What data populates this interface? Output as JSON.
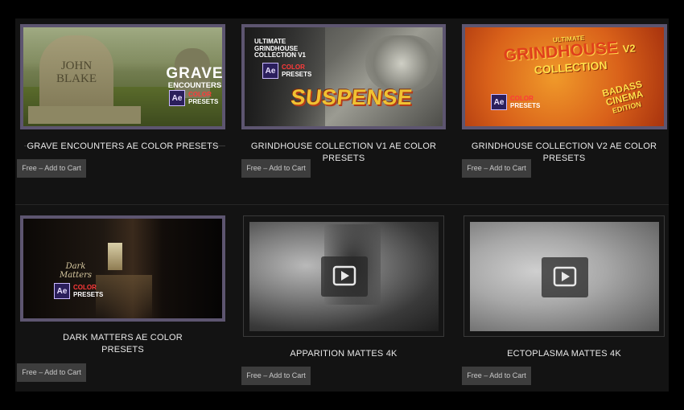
{
  "products": [
    {
      "title": "GRAVE ENCOUNTERS AE COLOR PRESETS",
      "button": "Free – Add to Cart",
      "thumb": {
        "headline_1": "GRAVE",
        "headline_2": "ENCOUNTERS",
        "stone_1": "JOHN",
        "stone_2": "BLAKE",
        "ae": "Ae",
        "ae_line_1": "COLOR",
        "ae_line_2": "PRESETS"
      }
    },
    {
      "title": "GRINDHOUSE COLLECTION V1 AE COLOR PRESETS",
      "button": "Free – Add to Cart",
      "thumb": {
        "top_1": "ULTIMATE",
        "top_2": "GRINDHOUSE",
        "top_3": "COLLECTION V1",
        "ae": "Ae",
        "ae_line_1": "COLOR",
        "ae_line_2": "PRESETS",
        "headline": "SUSPENSE"
      }
    },
    {
      "title": "GRINDHOUSE COLLECTION V2 AE COLOR PRESETS",
      "button": "Free – Add to Cart",
      "thumb": {
        "top_1": "ULTIMATE",
        "top_2": "GRINDHOUSE",
        "version": "V2",
        "top_3": "COLLECTION",
        "ae": "Ae",
        "ae_line_1": "COLOR",
        "ae_line_2": "PRESETS",
        "badge_1": "BADASS",
        "badge_2": "CINEMA",
        "badge_3": "EDITION"
      }
    },
    {
      "title_line_1": "DARK MATTERS AE COLOR",
      "title_line_2": "PRESETS",
      "button": "Free – Add to Cart",
      "thumb": {
        "script_1": "Dark",
        "script_2": "Matters",
        "ae": "Ae",
        "ae_line_1": "COLOR",
        "ae_line_2": "PRESETS"
      }
    },
    {
      "title": "APPARITION MATTES 4K",
      "button": "Free – Add to Cart"
    },
    {
      "title": "ECTOPLASMA MATTES 4K",
      "button": "Free – Add to Cart"
    }
  ],
  "colors": {
    "frame": "#5d5570",
    "button_bg": "#3d3d3d",
    "panel": "#131313"
  }
}
